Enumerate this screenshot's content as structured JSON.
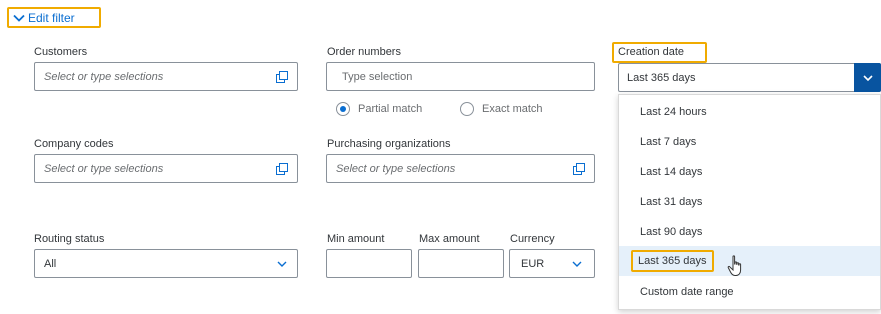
{
  "header": {
    "edit_filter_label": "Edit filter"
  },
  "customers": {
    "label": "Customers",
    "placeholder": "Select or type selections"
  },
  "order_numbers": {
    "label": "Order numbers",
    "placeholder": "Type selection"
  },
  "match": {
    "partial_label": "Partial match",
    "exact_label": "Exact match",
    "selected": "partial"
  },
  "creation_date": {
    "label": "Creation date",
    "value": "Last 365 days",
    "options": [
      "Last 24 hours",
      "Last 7 days",
      "Last 14 days",
      "Last 31 days",
      "Last 90 days",
      "Last 365 days",
      "Custom date range"
    ],
    "selected_index": 5
  },
  "company_codes": {
    "label": "Company codes",
    "placeholder": "Select or type selections"
  },
  "purchasing_orgs": {
    "label": "Purchasing organizations",
    "placeholder": "Select or type selections"
  },
  "routing_status": {
    "label": "Routing status",
    "value": "All"
  },
  "min_amount": {
    "label": "Min amount",
    "value": ""
  },
  "max_amount": {
    "label": "Max amount",
    "value": ""
  },
  "currency": {
    "label": "Currency",
    "value": "EUR"
  },
  "colors": {
    "accent": "#0a6ed1",
    "highlight": "#f0ab00",
    "dropdown_button": "#0854a0",
    "selected_option_bg": "#e5f0fa"
  },
  "icons": {
    "value_help": "value-help-icon",
    "dropdown": "chevron-down-icon",
    "cursor": "hand-cursor-icon"
  }
}
